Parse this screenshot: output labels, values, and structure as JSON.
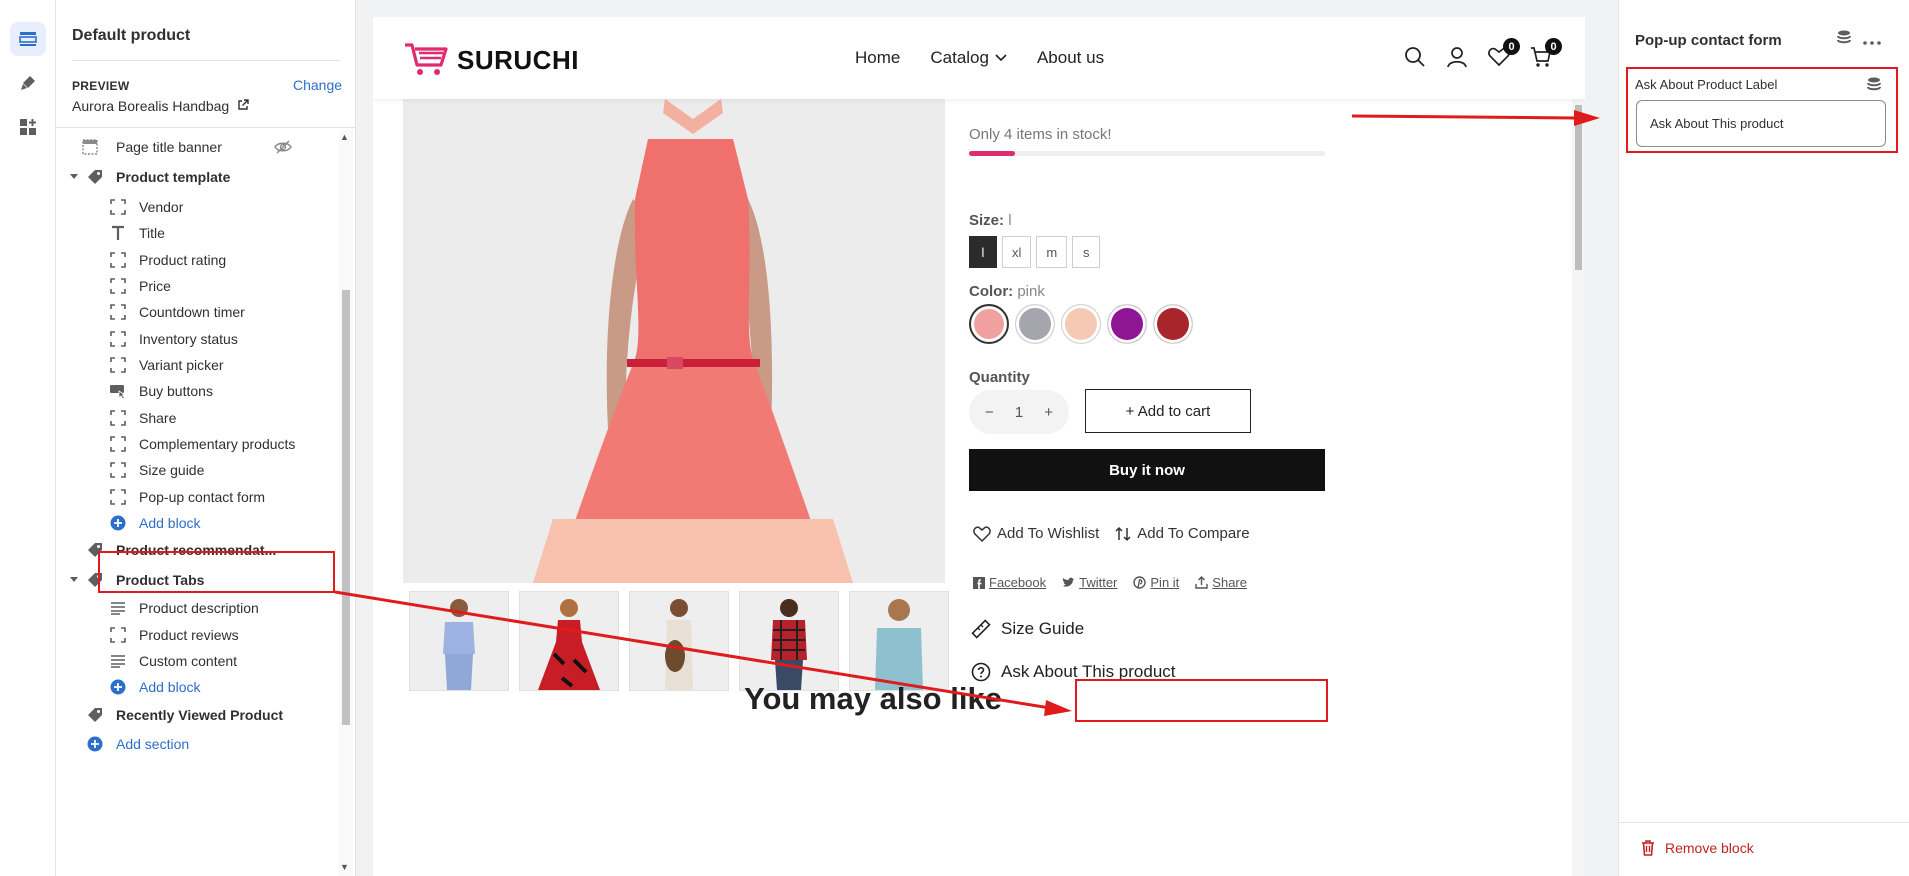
{
  "sidebar": {
    "title": "Default product",
    "preview_caption": "PREVIEW",
    "preview_change": "Change",
    "preview_product": "Aurora Borealis Handbag",
    "items": [
      {
        "label": "Page title banner"
      },
      {
        "label": "Product template"
      },
      {
        "label": "Vendor"
      },
      {
        "label": "Title"
      },
      {
        "label": "Product rating"
      },
      {
        "label": "Price"
      },
      {
        "label": "Countdown timer"
      },
      {
        "label": "Inventory status"
      },
      {
        "label": "Variant picker"
      },
      {
        "label": "Buy buttons"
      },
      {
        "label": "Share"
      },
      {
        "label": "Complementary products"
      },
      {
        "label": "Size guide"
      },
      {
        "label": "Pop-up contact form"
      },
      {
        "label": "Add block"
      },
      {
        "label": "Product recommendat..."
      },
      {
        "label": "Product Tabs"
      },
      {
        "label": "Product description"
      },
      {
        "label": "Product reviews"
      },
      {
        "label": "Custom content"
      },
      {
        "label": "Add block"
      },
      {
        "label": "Recently Viewed Product"
      },
      {
        "label": "Add section"
      }
    ]
  },
  "store": {
    "logo": "SURUCHI",
    "nav": [
      "Home",
      "Catalog",
      "About us"
    ],
    "wishlist_count": "0",
    "cart_count": "0"
  },
  "product": {
    "stock_text": "Only 4 items in stock!",
    "stock_level": 0.13,
    "size_label": "Size:",
    "size_value": "l",
    "sizes": [
      "l",
      "xl",
      "m",
      "s"
    ],
    "color_label": "Color:",
    "color_value": "pink",
    "quantity_label": "Quantity",
    "quantity": "1",
    "qty_minus": "−",
    "qty_plus": "+",
    "add_to_cart": "+ Add to cart",
    "buy_now": "Buy it now",
    "wishlist": "Add To Wishlist",
    "compare": "Add To Compare",
    "share_links": [
      "Facebook",
      "Twitter",
      "Pin it",
      "Share"
    ],
    "size_guide": "Size Guide",
    "ask_about": "Ask About This product",
    "also_like": "You may also like"
  },
  "settings": {
    "title": "Pop-up contact form",
    "field_label": "Ask About Product Label",
    "field_value": "Ask About This product",
    "remove": "Remove block"
  },
  "colors": {
    "accent": "#2c6ecb",
    "brand": "#e02b6f",
    "annotation": "#e01b1b",
    "danger": "#c22222"
  }
}
